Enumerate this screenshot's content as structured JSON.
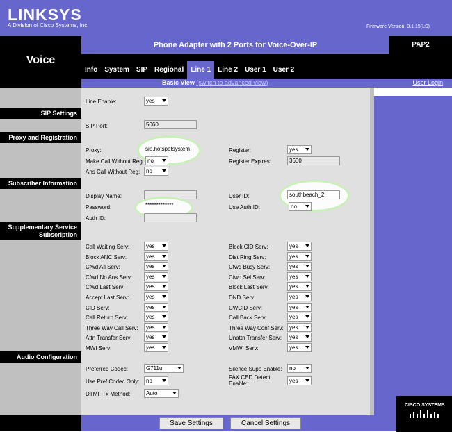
{
  "header": {
    "brand": "LINKSYS",
    "brand_sub": "A Division of Cisco Systems, Inc.",
    "firmware": "Firmware Version: 3.1.15(LS)",
    "section": "Voice",
    "product": "Phone Adapter with 2 Ports for Voice-Over-IP",
    "model": "PAP2"
  },
  "tabs": [
    "Info",
    "System",
    "SIP",
    "Regional",
    "Line 1",
    "Line 2",
    "User 1",
    "User 2"
  ],
  "view": {
    "basic": "Basic View",
    "switch": "(switch to advanced view)",
    "user_login": "User Login"
  },
  "sections": {
    "sip": "SIP Settings",
    "proxy": "Proxy and Registration",
    "subscriber": "Subscriber Information",
    "supp1": "Supplementary Service",
    "supp2": "Subscription",
    "audio": "Audio Configuration"
  },
  "form": {
    "line_enable": {
      "label": "Line Enable:",
      "value": "yes"
    },
    "sip_port": {
      "label": "SIP Port:",
      "value": "5060"
    },
    "proxy": {
      "label": "Proxy:",
      "value": "sip.hotspotsystem"
    },
    "register": {
      "label": "Register:",
      "value": "yes"
    },
    "make_call": {
      "label": "Make Call Without Reg:",
      "value": "no"
    },
    "register_expires": {
      "label": "Register Expires:",
      "value": "3600"
    },
    "ans_call": {
      "label": "Ans Call Without Reg:",
      "value": "no"
    },
    "display_name": {
      "label": "Display Name:",
      "value": ""
    },
    "user_id": {
      "label": "User ID:",
      "value": "southbeach_2"
    },
    "password": {
      "label": "Password:",
      "value": "*************"
    },
    "use_auth": {
      "label": "Use Auth ID:",
      "value": "no"
    },
    "auth_id": {
      "label": "Auth ID:",
      "value": ""
    }
  },
  "supp_left": [
    {
      "label": "Call Waiting Serv:",
      "value": "yes"
    },
    {
      "label": "Block ANC Serv:",
      "value": "yes"
    },
    {
      "label": "Cfwd All Serv:",
      "value": "yes"
    },
    {
      "label": "Cfwd No Ans Serv:",
      "value": "yes"
    },
    {
      "label": "Cfwd Last Serv:",
      "value": "yes"
    },
    {
      "label": "Accept Last Serv:",
      "value": "yes"
    },
    {
      "label": "CID Serv:",
      "value": "yes"
    },
    {
      "label": "Call Return Serv:",
      "value": "yes"
    },
    {
      "label": "Three Way Call Serv:",
      "value": "yes"
    },
    {
      "label": "Attn Transfer Serv:",
      "value": "yes"
    },
    {
      "label": "MWI Serv:",
      "value": "yes"
    }
  ],
  "supp_right": [
    {
      "label": "Block CID Serv:",
      "value": "yes"
    },
    {
      "label": "Dist Ring Serv:",
      "value": "yes"
    },
    {
      "label": "Cfwd Busy Serv:",
      "value": "yes"
    },
    {
      "label": "Cfwd Sel Serv:",
      "value": "yes"
    },
    {
      "label": "Block Last Serv:",
      "value": "yes"
    },
    {
      "label": "DND Serv:",
      "value": "yes"
    },
    {
      "label": "CWCID Serv:",
      "value": "yes"
    },
    {
      "label": "Call Back Serv:",
      "value": "yes"
    },
    {
      "label": "Three Way Conf Serv:",
      "value": "yes"
    },
    {
      "label": "Unattn Transfer Serv:",
      "value": "yes"
    },
    {
      "label": "VMWI Serv:",
      "value": "yes"
    }
  ],
  "audio": {
    "preferred_codec": {
      "label": "Preferred Codec:",
      "value": "G711u"
    },
    "silence_supp": {
      "label": "Silence Supp Enable:",
      "value": "no"
    },
    "use_pref": {
      "label": "Use Pref Codec Only:",
      "value": "no"
    },
    "fax_ced_1": "FAX CED Detect",
    "fax_ced_2": "Enable:",
    "fax_ced_value": "yes",
    "dtmf": {
      "label": "DTMF Tx Method:",
      "value": "Auto"
    }
  },
  "buttons": {
    "save": "Save Settings",
    "cancel": "Cancel Settings"
  },
  "footer": {
    "cisco": "CISCO SYSTEMS"
  },
  "colors": {
    "accent": "#6666cc",
    "panel": "#e0e0e0",
    "side": "#c0c0c0",
    "highlight": "#c8f0b8"
  }
}
